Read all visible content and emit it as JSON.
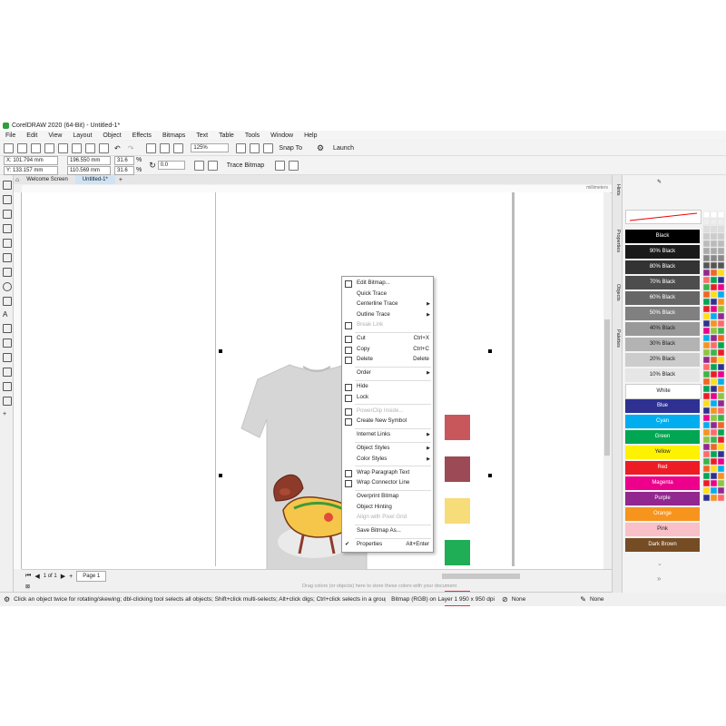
{
  "window": {
    "title": "CorelDRAW 2020 (64-Bit) - Untitled-1*"
  },
  "menu": [
    "File",
    "Edit",
    "View",
    "Layout",
    "Object",
    "Effects",
    "Bitmaps",
    "Text",
    "Table",
    "Tools",
    "Window",
    "Help"
  ],
  "toolbar": {
    "zoom": "125%",
    "snap_to": "Snap To",
    "launch": "Launch"
  },
  "properties": {
    "x": "X: 101.794 mm",
    "y": "Y: 133.157 mm",
    "w": "196.550 mm",
    "h": "110.569 mm",
    "sw": "31.6",
    "sh": "31.6",
    "pct": "%",
    "rotation": "0.0",
    "trace_bitmap": "Trace Bitmap"
  },
  "tabs": [
    "Welcome Screen",
    "Untitled-1*"
  ],
  "ruler_units": "millimeters",
  "page_tab": "Page 1",
  "hint_bar": "Drag colors (or objects) here to store these colors with your document",
  "status": {
    "hint": "Click an object twice for rotating/skewing; dbl-clicking tool selects all objects; Shift+click multi-selects; Alt+click digs; Ctrl+click selects in a group",
    "selection": "Bitmap (RGB) on Layer 1 950 x 950 dpi",
    "fill": "None",
    "outline": "None"
  },
  "dockers": [
    "Hints",
    "Properties",
    "Objects",
    "Palettes"
  ],
  "swatches_on_page": [
    "#c8575c",
    "#9c4a55",
    "#f7dc7a",
    "#1fad55",
    "#e23146"
  ],
  "palette": [
    {
      "name": "Black",
      "color": "#000000",
      "text": "#ffffff"
    },
    {
      "name": "90% Black",
      "color": "#1a1a1a",
      "text": "#ffffff"
    },
    {
      "name": "80% Black",
      "color": "#333333",
      "text": "#ffffff"
    },
    {
      "name": "70% Black",
      "color": "#4d4d4d",
      "text": "#ffffff"
    },
    {
      "name": "60% Black",
      "color": "#666666",
      "text": "#ffffff"
    },
    {
      "name": "50% Black",
      "color": "#808080",
      "text": "#ffffff"
    },
    {
      "name": "40% Black",
      "color": "#999999",
      "text": "#222222"
    },
    {
      "name": "30% Black",
      "color": "#b3b3b3",
      "text": "#222222"
    },
    {
      "name": "20% Black",
      "color": "#cccccc",
      "text": "#222222"
    },
    {
      "name": "10% Black",
      "color": "#e6e6e6",
      "text": "#222222"
    },
    {
      "name": "White",
      "color": "#ffffff",
      "text": "#222222"
    },
    {
      "name": "Blue",
      "color": "#2e3192",
      "text": "#ffffff"
    },
    {
      "name": "Cyan",
      "color": "#00aeef",
      "text": "#ffffff"
    },
    {
      "name": "Green",
      "color": "#00a651",
      "text": "#ffffff"
    },
    {
      "name": "Yellow",
      "color": "#fff200",
      "text": "#222222"
    },
    {
      "name": "Red",
      "color": "#ed1c24",
      "text": "#ffffff"
    },
    {
      "name": "Magenta",
      "color": "#ec008c",
      "text": "#ffffff"
    },
    {
      "name": "Purple",
      "color": "#92278f",
      "text": "#ffffff"
    },
    {
      "name": "Orange",
      "color": "#f7941d",
      "text": "#ffffff"
    },
    {
      "name": "Pink",
      "color": "#f9c0c7",
      "text": "#222222"
    },
    {
      "name": "Dark Brown",
      "color": "#754c24",
      "text": "#ffffff"
    }
  ],
  "context_menu": [
    {
      "label": "Edit Bitmap...",
      "shortcut": "",
      "arrow": false,
      "disabled": false,
      "icon": "edit-bitmap-icon"
    },
    {
      "label": "Quick Trace",
      "shortcut": "",
      "arrow": false,
      "disabled": false,
      "icon": ""
    },
    {
      "label": "Centerline Trace",
      "shortcut": "",
      "arrow": true,
      "disabled": false,
      "icon": ""
    },
    {
      "label": "Outline Trace",
      "shortcut": "",
      "arrow": true,
      "disabled": false,
      "icon": ""
    },
    {
      "label": "Break Link",
      "shortcut": "",
      "arrow": false,
      "disabled": true,
      "icon": "break-link-icon"
    },
    {
      "label": "Cut",
      "shortcut": "Ctrl+X",
      "arrow": false,
      "disabled": false,
      "icon": "cut-icon"
    },
    {
      "label": "Copy",
      "shortcut": "Ctrl+C",
      "arrow": false,
      "disabled": false,
      "icon": "copy-icon"
    },
    {
      "label": "Delete",
      "shortcut": "Delete",
      "arrow": false,
      "disabled": false,
      "icon": "delete-icon"
    },
    {
      "label": "Order",
      "shortcut": "",
      "arrow": true,
      "disabled": false,
      "icon": ""
    },
    {
      "label": "Hide",
      "shortcut": "",
      "arrow": false,
      "disabled": false,
      "icon": "eye-icon"
    },
    {
      "label": "Lock",
      "shortcut": "",
      "arrow": false,
      "disabled": false,
      "icon": "lock-icon"
    },
    {
      "label": "PowerClip Inside...",
      "shortcut": "",
      "arrow": false,
      "disabled": true,
      "icon": "powerclip-icon"
    },
    {
      "label": "Create New Symbol",
      "shortcut": "",
      "arrow": false,
      "disabled": false,
      "icon": "symbol-icon"
    },
    {
      "label": "Internet Links",
      "shortcut": "",
      "arrow": true,
      "disabled": false,
      "icon": ""
    },
    {
      "label": "Object Styles",
      "shortcut": "",
      "arrow": true,
      "disabled": false,
      "icon": ""
    },
    {
      "label": "Color Styles",
      "shortcut": "",
      "arrow": true,
      "disabled": false,
      "icon": ""
    },
    {
      "label": "Wrap Paragraph Text",
      "shortcut": "",
      "arrow": false,
      "disabled": false,
      "icon": "wrap-text-icon"
    },
    {
      "label": "Wrap Connector Line",
      "shortcut": "",
      "arrow": false,
      "disabled": false,
      "icon": "wrap-connector-icon"
    },
    {
      "label": "Overprint Bitmap",
      "shortcut": "",
      "arrow": false,
      "disabled": false,
      "icon": ""
    },
    {
      "label": "Object Hinting",
      "shortcut": "",
      "arrow": false,
      "disabled": false,
      "icon": ""
    },
    {
      "label": "Align with Pixel Grid",
      "shortcut": "",
      "arrow": false,
      "disabled": true,
      "icon": ""
    },
    {
      "label": "Save Bitmap As...",
      "shortcut": "",
      "arrow": false,
      "disabled": false,
      "icon": ""
    },
    {
      "label": "Properties",
      "shortcut": "Alt+Enter",
      "arrow": false,
      "disabled": false,
      "icon": "check-icon"
    }
  ]
}
